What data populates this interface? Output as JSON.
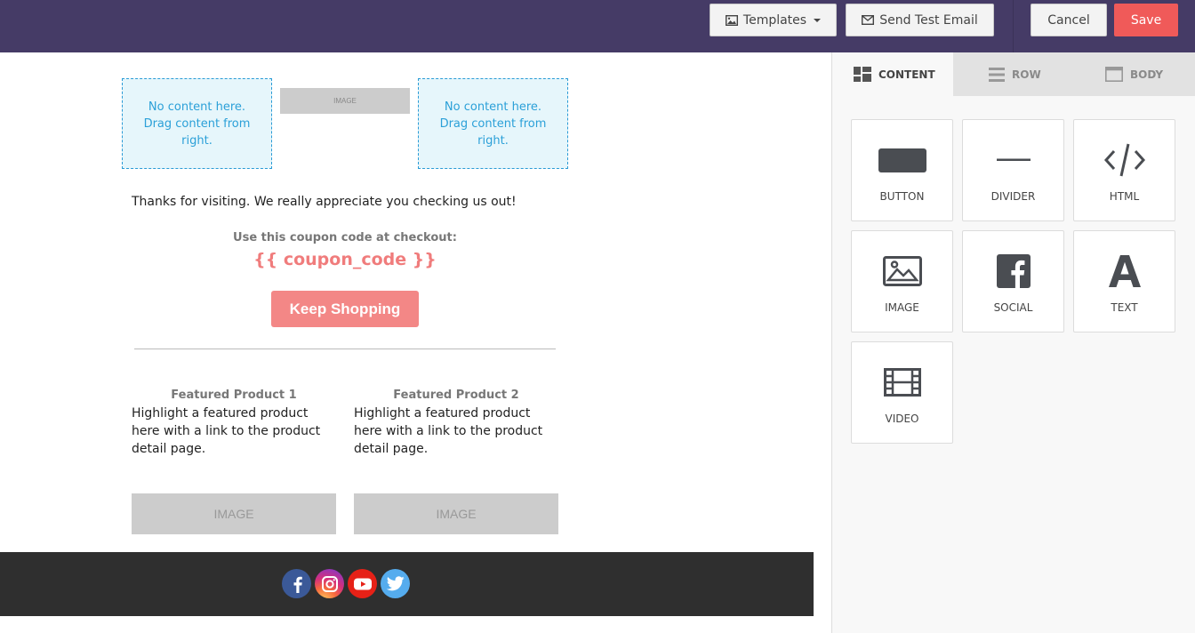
{
  "toolbar": {
    "templates_label": "Templates",
    "send_test_label": "Send Test Email",
    "cancel_label": "Cancel",
    "save_label": "Save",
    "save_color": "#f05a59"
  },
  "canvas": {
    "dropzone_text": "No content here. Drag content from right.",
    "image_label_small": "IMAGE",
    "thanks_text": "Thanks for visiting. We really appreciate you checking us out!",
    "coupon_label": "Use this coupon code at checkout:",
    "coupon_code": "{{ coupon_code }}",
    "keep_shopping_label": "Keep Shopping",
    "products": [
      {
        "title": "Featured Product 1",
        "description": "Highlight a featured product here with a link to the product detail page.",
        "image_label": "IMAGE"
      },
      {
        "title": "Featured Product 2",
        "description": "Highlight a featured product here with a link to the product detail page.",
        "image_label": "IMAGE"
      }
    ],
    "social_icons": [
      "facebook-icon",
      "instagram-icon",
      "youtube-icon",
      "twitter-icon"
    ]
  },
  "panel": {
    "tabs": [
      {
        "label": "CONTENT",
        "icon": "grid-icon",
        "active": true
      },
      {
        "label": "ROW",
        "icon": "rows-icon",
        "active": false
      },
      {
        "label": "BODY",
        "icon": "window-icon",
        "active": false
      }
    ],
    "tiles": [
      {
        "label": "BUTTON",
        "icon": "button-icon"
      },
      {
        "label": "DIVIDER",
        "icon": "divider-icon"
      },
      {
        "label": "HTML",
        "icon": "code-icon"
      },
      {
        "label": "IMAGE",
        "icon": "image-icon"
      },
      {
        "label": "SOCIAL",
        "icon": "facebook-icon"
      },
      {
        "label": "TEXT",
        "icon": "text-icon"
      },
      {
        "label": "VIDEO",
        "icon": "film-icon"
      }
    ]
  },
  "colors": {
    "topbar": "#453b66",
    "accent_button": "#f38786",
    "coupon": "#f07c7c",
    "dropzone_text": "#2ba0d8"
  }
}
